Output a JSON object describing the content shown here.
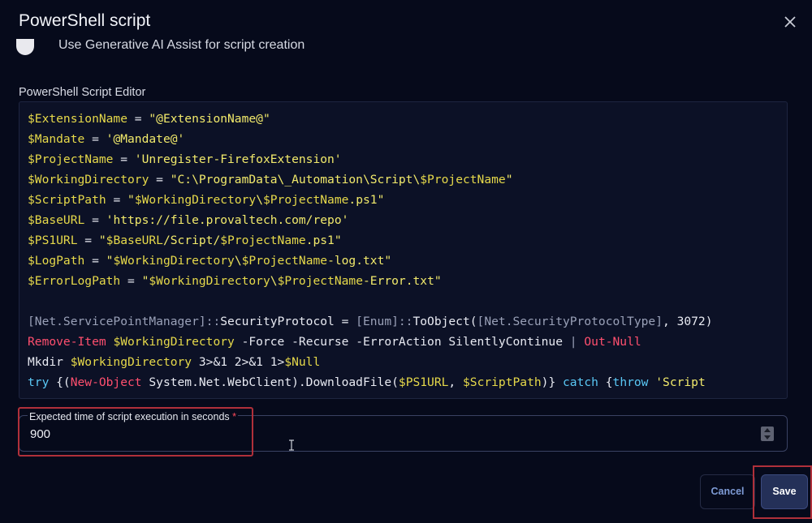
{
  "dialog": {
    "title": "PowerShell script",
    "close_icon": "close-icon"
  },
  "ai_assist": {
    "label": "Use Generative AI Assist for script creation",
    "enabled": false
  },
  "editor": {
    "label": "PowerShell Script Editor",
    "lines": [
      [
        [
          "var",
          "$ExtensionName"
        ],
        [
          "op",
          " = "
        ],
        [
          "str",
          "\"@ExtensionName@\""
        ]
      ],
      [
        [
          "var",
          "$Mandate"
        ],
        [
          "op",
          " = "
        ],
        [
          "str",
          "'@Mandate@'"
        ]
      ],
      [
        [
          "var",
          "$ProjectName"
        ],
        [
          "op",
          " = "
        ],
        [
          "str",
          "'Unregister-FirefoxExtension'"
        ]
      ],
      [
        [
          "var",
          "$WorkingDirectory"
        ],
        [
          "op",
          " = "
        ],
        [
          "str",
          "\"C:\\ProgramData\\_Automation\\Script\\"
        ],
        [
          "var",
          "$ProjectName"
        ],
        [
          "str",
          "\""
        ]
      ],
      [
        [
          "var",
          "$ScriptPath"
        ],
        [
          "op",
          " = "
        ],
        [
          "str",
          "\""
        ],
        [
          "var",
          "$WorkingDirectory"
        ],
        [
          "str",
          "\\"
        ],
        [
          "var",
          "$ProjectName"
        ],
        [
          "str",
          ".ps1\""
        ]
      ],
      [
        [
          "var",
          "$BaseURL"
        ],
        [
          "op",
          " = "
        ],
        [
          "str",
          "'https://file.provaltech.com/repo'"
        ]
      ],
      [
        [
          "var",
          "$PS1URL"
        ],
        [
          "op",
          " = "
        ],
        [
          "str",
          "\""
        ],
        [
          "var",
          "$BaseURL"
        ],
        [
          "str",
          "/Script/"
        ],
        [
          "var",
          "$ProjectName"
        ],
        [
          "str",
          ".ps1\""
        ]
      ],
      [
        [
          "var",
          "$LogPath"
        ],
        [
          "op",
          " = "
        ],
        [
          "str",
          "\""
        ],
        [
          "var",
          "$WorkingDirectory"
        ],
        [
          "str",
          "\\"
        ],
        [
          "var",
          "$ProjectName"
        ],
        [
          "str",
          "-log.txt\""
        ]
      ],
      [
        [
          "var",
          "$ErrorLogPath"
        ],
        [
          "op",
          " = "
        ],
        [
          "str",
          "\""
        ],
        [
          "var",
          "$WorkingDirectory"
        ],
        [
          "str",
          "\\"
        ],
        [
          "var",
          "$ProjectName"
        ],
        [
          "str",
          "-Error.txt\""
        ]
      ],
      [],
      [
        [
          "type",
          "[Net.ServicePointManager]::"
        ],
        [
          "plain",
          "SecurityProtocol = "
        ],
        [
          "type",
          "[Enum]::"
        ],
        [
          "plain",
          "ToObject("
        ],
        [
          "type",
          "[Net.SecurityProtocolType]"
        ],
        [
          "plain",
          ", 3072)"
        ]
      ],
      [
        [
          "cmd",
          "Remove-Item"
        ],
        [
          "plain",
          " "
        ],
        [
          "var",
          "$WorkingDirectory"
        ],
        [
          "plain",
          " -Force -Recurse -ErrorAction SilentlyContinue "
        ],
        [
          "type",
          "|"
        ],
        [
          "plain",
          " "
        ],
        [
          "cmd",
          "Out-Null"
        ]
      ],
      [
        [
          "plain",
          "Mkdir "
        ],
        [
          "var",
          "$WorkingDirectory"
        ],
        [
          "plain",
          " 3>&1 2>&1 1>"
        ],
        [
          "var",
          "$Null"
        ]
      ],
      [
        [
          "kw",
          "try"
        ],
        [
          "plain",
          " {("
        ],
        [
          "cmd",
          "New-Object"
        ],
        [
          "plain",
          " System.Net.WebClient).DownloadFile("
        ],
        [
          "var",
          "$PS1URL"
        ],
        [
          "plain",
          ", "
        ],
        [
          "var",
          "$ScriptPath"
        ],
        [
          "plain",
          ")} "
        ],
        [
          "kw",
          "catch"
        ],
        [
          "plain",
          " {"
        ],
        [
          "kw",
          "throw"
        ],
        [
          "str",
          " 'Script"
        ]
      ]
    ]
  },
  "execution_time": {
    "label": "Expected time of script execution in seconds",
    "required_mark": "*",
    "value": "900"
  },
  "actions": {
    "cancel_label": "Cancel",
    "save_label": "Save"
  },
  "colors": {
    "background": "#060a1b",
    "accent": "#243058",
    "highlight": "#b0303a",
    "variable": "#e6d94a",
    "string": "#f2ea6b",
    "cmdlet": "#ff4f6e",
    "keyword": "#5ac8f5"
  }
}
